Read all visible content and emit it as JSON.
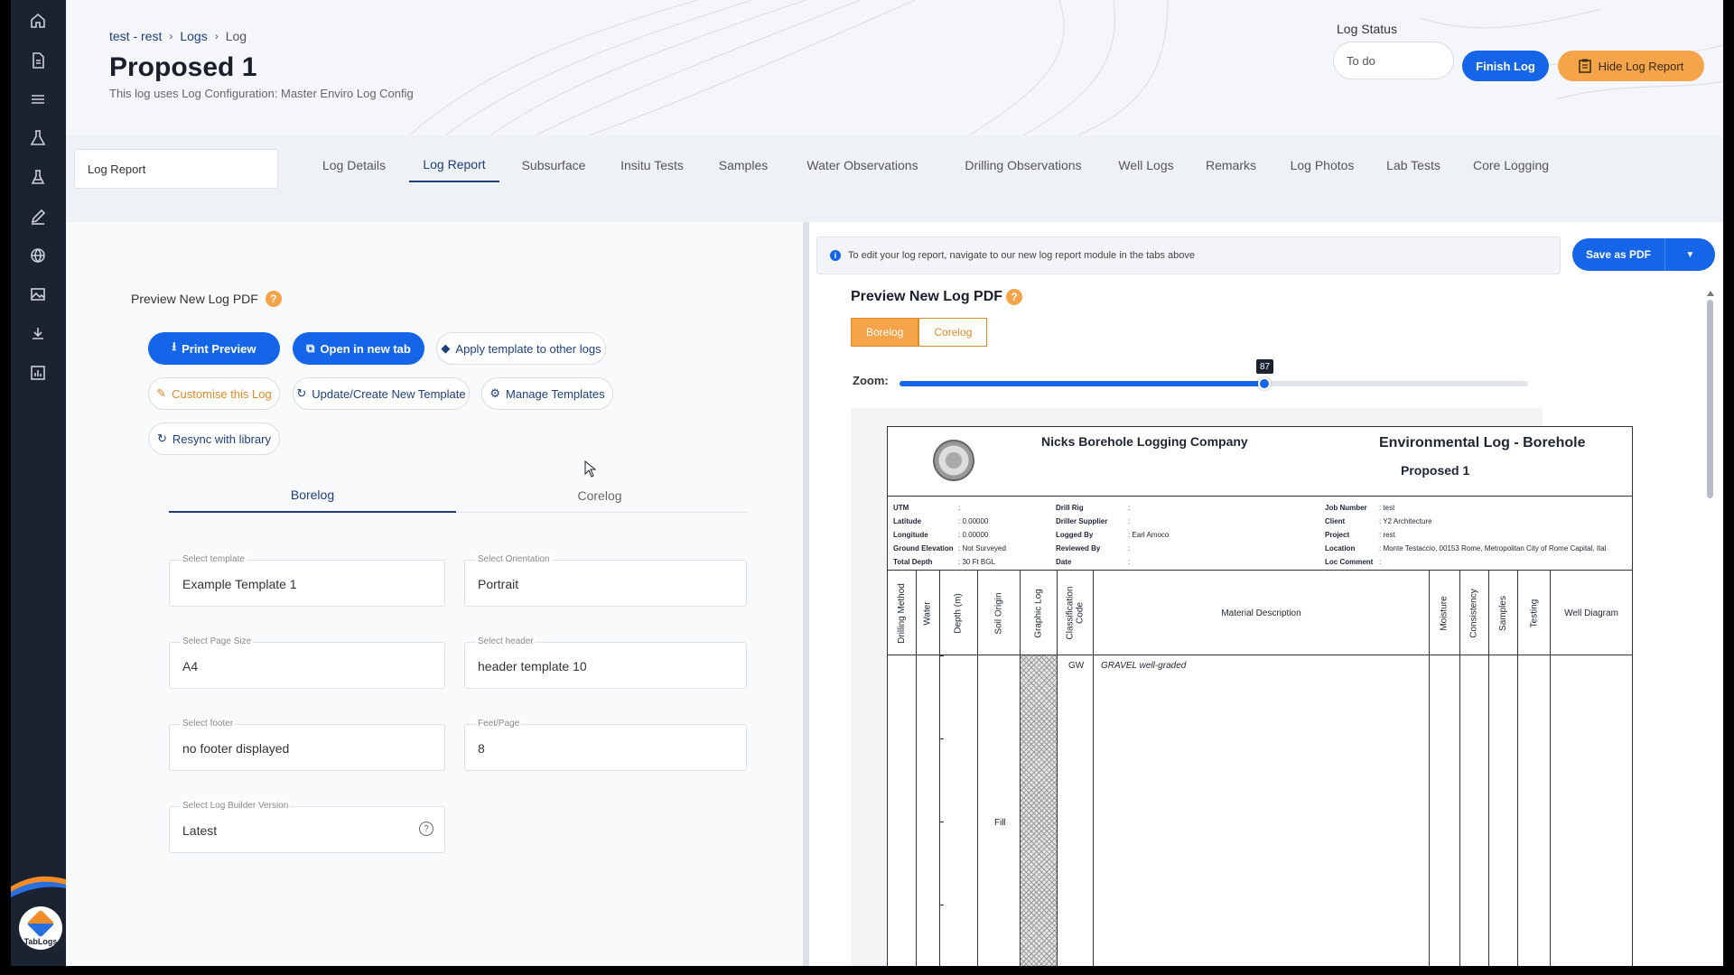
{
  "breadcrumb": {
    "project": "test - rest",
    "logs": "Logs",
    "current": "Log"
  },
  "header": {
    "title": "Proposed 1",
    "subtitle": "This log uses Log Configuration: Master Enviro Log Config",
    "log_status_label": "Log Status",
    "log_status_value": "To do",
    "finish_log": "Finish Log",
    "hide_log_report": "Hide Log Report"
  },
  "report_select": "Log Report",
  "tabs": [
    {
      "label": "Log Details"
    },
    {
      "label": "Log Report"
    },
    {
      "label": "Subsurface"
    },
    {
      "label": "Insitu Tests"
    },
    {
      "label": "Samples"
    },
    {
      "label": "Water Observations"
    },
    {
      "label": "Drilling Observations"
    },
    {
      "label": "Well Logs"
    },
    {
      "label": "Remarks"
    },
    {
      "label": "Log Photos"
    },
    {
      "label": "Lab Tests"
    },
    {
      "label": "Core Logging"
    }
  ],
  "active_tab": "Log Report",
  "left": {
    "preview_label": "Preview New Log PDF",
    "help": "?",
    "buttons": {
      "print_preview": "Print Preview",
      "open_new_tab": "Open in new tab",
      "apply_template": "Apply template to other logs",
      "customise": "Customise this Log",
      "update_template": "Update/Create New Template",
      "manage_templates": "Manage Templates",
      "resync": "Resync with library"
    },
    "sub_tabs": [
      "Borelog",
      "Corelog"
    ],
    "fields": {
      "template": {
        "label": "Select template",
        "value": "Example Template 1"
      },
      "orientation": {
        "label": "Select Orientation",
        "value": "Portrait"
      },
      "page_size": {
        "label": "Select Page Size",
        "value": "A4"
      },
      "header": {
        "label": "Select header",
        "value": "header template 10"
      },
      "footer": {
        "label": "Select footer",
        "value": "no footer displayed"
      },
      "feet_page": {
        "label": "Feet/Page",
        "value": "8"
      },
      "builder_version": {
        "label": "Select Log Builder Version",
        "value": "Latest"
      }
    }
  },
  "right": {
    "info_text": "To edit your log report, navigate to our new log report module in the tabs above",
    "info_icon": "i",
    "save_pdf": "Save as PDF",
    "preview_title": "Preview New Log PDF",
    "toggle": [
      "Borelog",
      "Corelog"
    ],
    "zoom_label": "Zoom:",
    "zoom_value": 87,
    "zoom_display": "87"
  },
  "document": {
    "company": "Nicks Borehole Logging Company",
    "log_title": "Environmental Log - Borehole",
    "log_name": "Proposed 1",
    "meta_left": [
      {
        "k": "UTM",
        "v": ":"
      },
      {
        "k": "Latitude",
        "v": ": 0.00000"
      },
      {
        "k": "Longitude",
        "v": ": 0.00000"
      },
      {
        "k": "Ground Elevation",
        "v": ": Not Surveyed"
      },
      {
        "k": "Total Depth",
        "v": ": 30 Ft BGL"
      }
    ],
    "meta_mid": [
      {
        "k": "Drill Rig",
        "v": ":"
      },
      {
        "k": "Driller Supplier",
        "v": ":"
      },
      {
        "k": "Logged By",
        "v": ": Earl Amoco"
      },
      {
        "k": "Reviewed By",
        "v": ":"
      },
      {
        "k": "Date",
        "v": ":"
      }
    ],
    "meta_right": [
      {
        "k": "Job Number",
        "v": ": test"
      },
      {
        "k": "Client",
        "v": ": Y2 Architecture"
      },
      {
        "k": "Project",
        "v": ": rest"
      },
      {
        "k": "Location",
        "v": ": Monte Testaccio, 00153 Rome, Metropolitan City of Rome Capital, Ital"
      },
      {
        "k": "Loc Comment",
        "v": ":"
      }
    ],
    "columns": [
      "Drilling Method",
      "Water",
      "Depth (m)",
      "Soil Origin",
      "Graphic Log",
      "Classification Code",
      "Material Description",
      "Moisture",
      "Consistency",
      "Samples",
      "Testing",
      "Well Diagram"
    ],
    "rows": {
      "code": "GW",
      "description": "GRAVEL well-graded",
      "origin": "Fill"
    }
  },
  "sidebar": {
    "logo_text": "TabLogs"
  },
  "colors": {
    "primary": "#1565e8",
    "accent": "#f5a44a",
    "sidebar": "#1b2230"
  }
}
